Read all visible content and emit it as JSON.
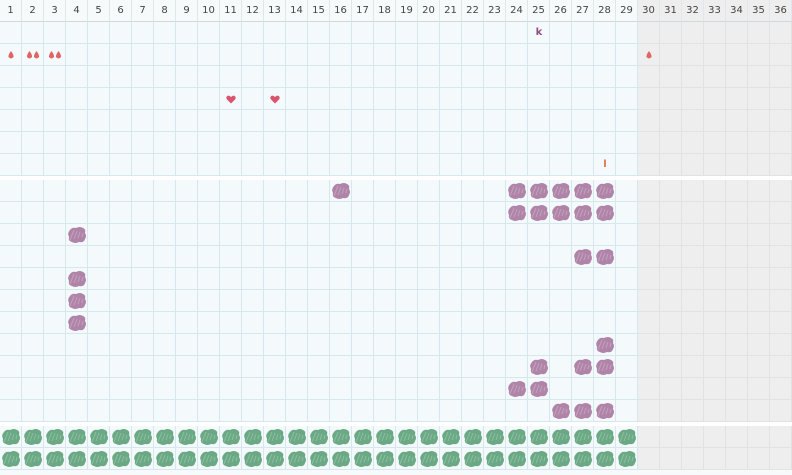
{
  "columns": [
    "1",
    "2",
    "3",
    "4",
    "5",
    "6",
    "7",
    "8",
    "9",
    "10",
    "11",
    "12",
    "13",
    "14",
    "15",
    "16",
    "17",
    "18",
    "19",
    "20",
    "21",
    "22",
    "23",
    "24",
    "25",
    "26",
    "27",
    "28",
    "29",
    "30",
    "31",
    "32",
    "33",
    "34",
    "35",
    "36"
  ],
  "active_columns": 29,
  "colors": {
    "drop": "#e06666",
    "heart": "#d9556f",
    "purple_blob": "#b084a8",
    "green_blob": "#6aa984",
    "out_of_range": "#eeeeee",
    "grid_line": "#d6e8ee"
  },
  "top_section": {
    "rows": 7,
    "marks": [
      {
        "type": "drop",
        "col": 1,
        "row": 2,
        "count": 1
      },
      {
        "type": "drop",
        "col": 2,
        "row": 2,
        "count": 2
      },
      {
        "type": "drop",
        "col": 3,
        "row": 2,
        "count": 2
      },
      {
        "type": "drop",
        "col": 30,
        "row": 2,
        "count": 1
      },
      {
        "type": "heart",
        "col": 11,
        "row": 4
      },
      {
        "type": "heart",
        "col": 13,
        "row": 4
      },
      {
        "type": "text",
        "col": 25,
        "row": 1,
        "text": "k",
        "color": "#8b4f7f"
      },
      {
        "type": "text",
        "col": 28,
        "row": 7,
        "text": "l",
        "color": "#e07050"
      }
    ]
  },
  "middle_section": {
    "rows": 11,
    "purple_cells": [
      [
        16,
        1
      ],
      [
        24,
        1
      ],
      [
        25,
        1
      ],
      [
        26,
        1
      ],
      [
        27,
        1
      ],
      [
        28,
        1
      ],
      [
        24,
        2
      ],
      [
        25,
        2
      ],
      [
        26,
        2
      ],
      [
        27,
        2
      ],
      [
        28,
        2
      ],
      [
        4,
        3
      ],
      [
        27,
        4
      ],
      [
        28,
        4
      ],
      [
        4,
        5
      ],
      [
        4,
        6
      ],
      [
        4,
        7
      ],
      [
        28,
        8
      ],
      [
        25,
        9
      ],
      [
        27,
        9
      ],
      [
        28,
        9
      ],
      [
        24,
        10
      ],
      [
        25,
        10
      ],
      [
        26,
        11
      ],
      [
        27,
        11
      ],
      [
        28,
        11
      ]
    ]
  },
  "bottom_section": {
    "rows": 2,
    "green_cols": 29
  }
}
